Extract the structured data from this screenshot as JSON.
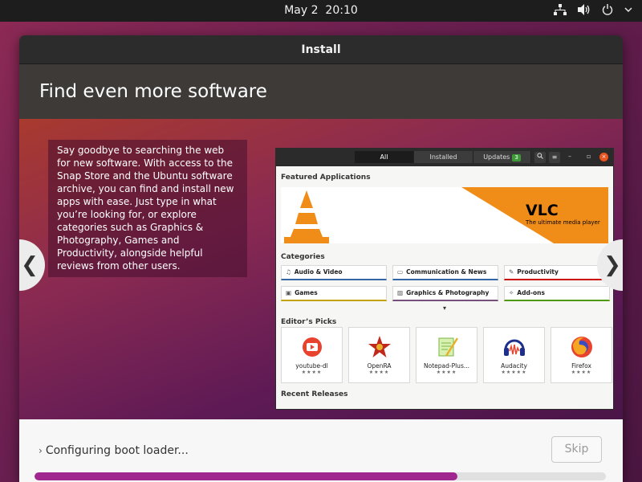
{
  "topbar": {
    "date": "May 2",
    "time": "20:10",
    "icons": [
      "network-icon",
      "volume-icon",
      "power-icon",
      "chevron-down-icon"
    ]
  },
  "window": {
    "title": "Install",
    "heading": "Find even more software",
    "description": "Say goodbye to searching the web for new software. With access to the Snap Store and the Ubuntu software archive, you can find and install new apps with ease. Just type in what you’re looking for, or explore categories such as Graphics & Photography, Games and Productivity, alongside helpful reviews from other users.",
    "nav_prev": "❮",
    "nav_next": "❯"
  },
  "store": {
    "tabs": [
      {
        "label": "All",
        "active": true
      },
      {
        "label": "Installed",
        "active": false
      },
      {
        "label": "Updates",
        "badge": "3",
        "active": false
      }
    ],
    "featured_title": "Featured Applications",
    "banner": {
      "app": "VLC",
      "tagline": "The ultimate media player"
    },
    "categories_title": "Categories",
    "categories": [
      {
        "label": "Audio & Video",
        "icon": "music-note-icon",
        "color": "#3465a4"
      },
      {
        "label": "Communication & News",
        "icon": "chat-icon",
        "color": "#3465a4"
      },
      {
        "label": "Productivity",
        "icon": "pencil-icon",
        "color": "#cc0000"
      },
      {
        "label": "Games",
        "icon": "gamepad-icon",
        "color": "#c4a000"
      },
      {
        "label": "Graphics & Photography",
        "icon": "image-icon",
        "color": "#75507b"
      },
      {
        "label": "Add-ons",
        "icon": "puzzle-icon",
        "color": "#4e9a06"
      }
    ],
    "more_glyph": "▾",
    "picks_title": "Editor’s Picks",
    "picks": [
      {
        "name": "youtube-dl",
        "stars": "★★★★"
      },
      {
        "name": "OpenRA",
        "stars": "★★★★"
      },
      {
        "name": "Notepad-Plus...",
        "stars": "★★★★"
      },
      {
        "name": "Audacity",
        "stars": "★★★★★"
      },
      {
        "name": "Firefox",
        "stars": "★★★★"
      }
    ],
    "recent_title": "Recent Releases"
  },
  "bottom": {
    "status": "Configuring boot loader...",
    "skip_label": "Skip",
    "progress": 0.74
  },
  "colors": {
    "accent": "#a0278f",
    "ubuntu_orange": "#e95420"
  }
}
